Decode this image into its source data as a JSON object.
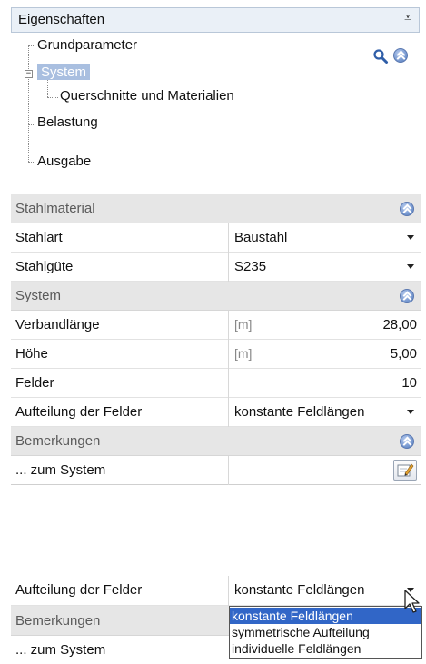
{
  "panel": {
    "title": "Eigenschaften",
    "pin_glyph": "⩡"
  },
  "tree": {
    "items": [
      {
        "label": "Grundparameter"
      },
      {
        "label": "System",
        "expander": "−"
      },
      {
        "label": "Querschnitte und Materialien"
      },
      {
        "label": "Belastung"
      },
      {
        "label": "Ausgabe"
      }
    ]
  },
  "grid": {
    "sections": {
      "stahlmaterial": "Stahlmaterial",
      "system": "System",
      "bemerkungen": "Bemerkungen"
    },
    "rows": {
      "stahlart": {
        "label": "Stahlart",
        "value": "Baustahl"
      },
      "stahlguete": {
        "label": "Stahlgüte",
        "value": "S235"
      },
      "verbandlaenge": {
        "label": "Verbandlänge",
        "unit": "[m]",
        "value": "28,00"
      },
      "hoehe": {
        "label": "Höhe",
        "unit": "[m]",
        "value": "5,00"
      },
      "felder": {
        "label": "Felder",
        "value": "10"
      },
      "aufteilung": {
        "label": "Aufteilung der Felder",
        "value": "konstante Feldlängen"
      },
      "zum_system": {
        "label": "... zum System"
      }
    }
  },
  "dropdown_demo": {
    "row_label": "Aufteilung der Felder",
    "row_value": "konstante Feldlängen",
    "section": "Bemerkungen",
    "zum_system": "... zum System",
    "options": [
      "konstante Feldlängen",
      "symmetrische Aufteilung",
      "individuelle Feldlängen"
    ],
    "selected_index": 0
  },
  "colors": {
    "selection": "#3166c7",
    "tree_selection": "#a9bfe0",
    "section_bg": "#e6e6e6",
    "collapse_icon": "#6f92cc"
  }
}
